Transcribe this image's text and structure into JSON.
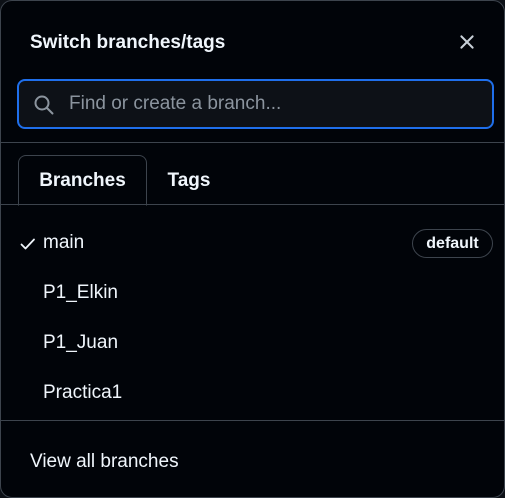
{
  "header": {
    "title": "Switch branches/tags",
    "close_icon": "close-icon"
  },
  "search": {
    "placeholder": "Find or create a branch...",
    "value": "",
    "icon": "search-icon"
  },
  "tabs": [
    {
      "label": "Branches",
      "active": true
    },
    {
      "label": "Tags",
      "active": false
    }
  ],
  "branches": [
    {
      "name": "main",
      "selected": true,
      "badge": "default"
    },
    {
      "name": "P1_Elkin",
      "selected": false
    },
    {
      "name": "P1_Juan",
      "selected": false
    },
    {
      "name": "Practica1",
      "selected": false
    }
  ],
  "footer": {
    "view_all_label": "View all branches"
  },
  "colors": {
    "background": "#010409",
    "border": "#3d444d",
    "focus_ring": "#1f6feb",
    "text": "#f0f6fc",
    "placeholder": "#8b949e"
  }
}
